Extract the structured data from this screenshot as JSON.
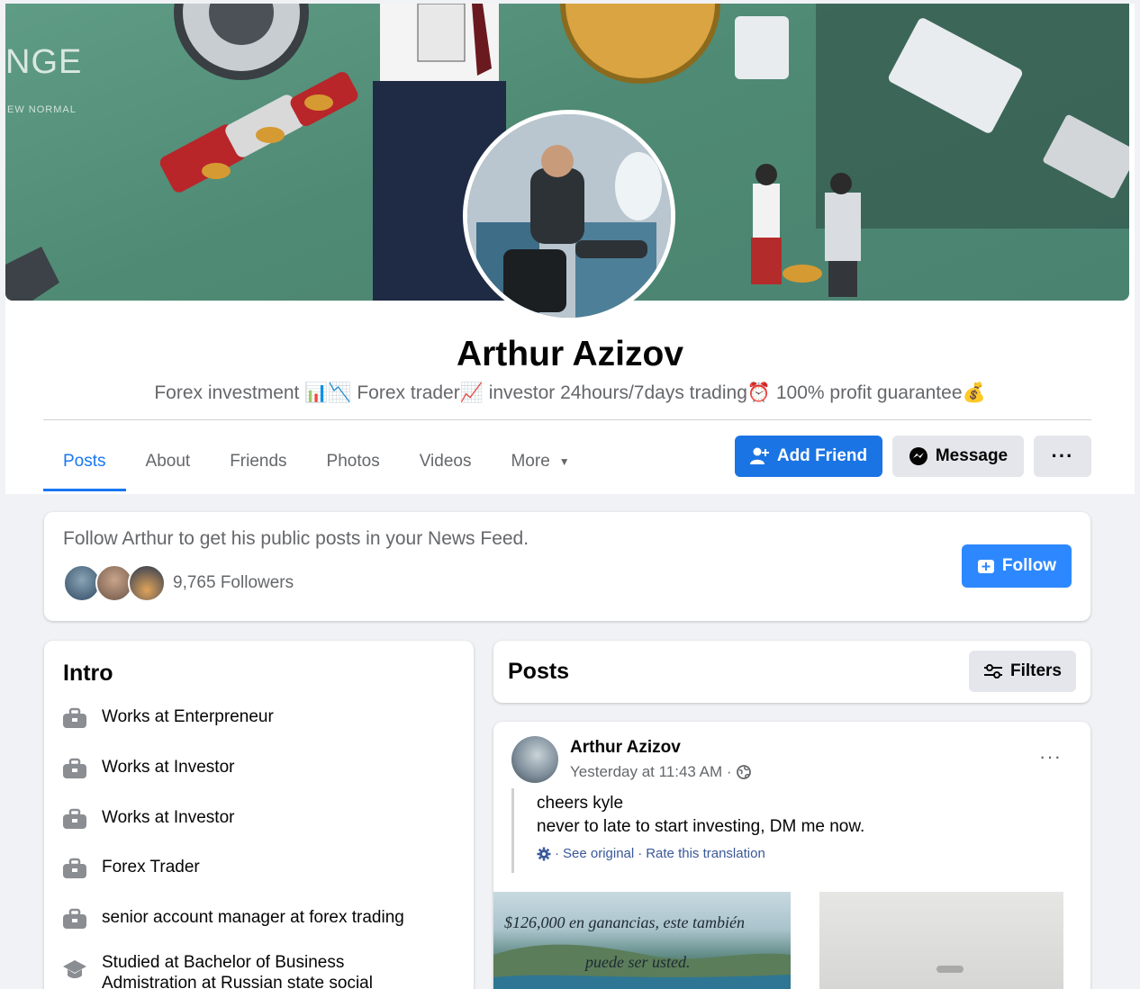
{
  "cover": {
    "text_big": "NGE",
    "text_small": "EW NORMAL"
  },
  "profile": {
    "name": "Arthur Azizov",
    "bio": "Forex investment 📊📉 Forex trader📈 investor 24hours/7days trading⏰ 100% profit guarantee💰"
  },
  "tabs": [
    {
      "label": "Posts",
      "active": true
    },
    {
      "label": "About"
    },
    {
      "label": "Friends"
    },
    {
      "label": "Photos"
    },
    {
      "label": "Videos"
    },
    {
      "label": "More"
    }
  ],
  "actions": {
    "add_friend": "Add Friend",
    "message": "Message",
    "more": "···"
  },
  "follow_card": {
    "text": "Follow Arthur to get his public posts in your News Feed.",
    "followers": "9,765 Followers",
    "button": "Follow"
  },
  "intro": {
    "title": "Intro",
    "items": [
      {
        "text": "Works at Enterpreneur",
        "icon": "briefcase-icon"
      },
      {
        "text": "Works at Investor",
        "icon": "briefcase-icon"
      },
      {
        "text": "Works at Investor",
        "icon": "briefcase-icon"
      },
      {
        "text": "Forex Trader",
        "icon": "briefcase-icon"
      },
      {
        "text": "senior account manager at forex trading",
        "icon": "briefcase-icon"
      },
      {
        "text": "Studied at Bachelor of Business Admistration at Russian state social",
        "icon": "graduation-cap-icon"
      }
    ]
  },
  "posts_header": {
    "title": "Posts",
    "filters": "Filters"
  },
  "post": {
    "author": "Arthur Azizov",
    "time": "Yesterday at 11:43 AM ·",
    "line1": "cheers kyle",
    "line2": "never to late to start investing, DM me now.",
    "see_original": "See original",
    "rate": "Rate this translation",
    "photo_caption1": "$126,000 en ganancias, este también",
    "photo_caption2": "puede ser usted."
  },
  "colors": {
    "accent": "#1877f2",
    "button_blue": "#1b74e4",
    "follow_blue": "#2d88ff",
    "gray_button": "#e4e6eb",
    "secondary_text": "#65676b"
  }
}
